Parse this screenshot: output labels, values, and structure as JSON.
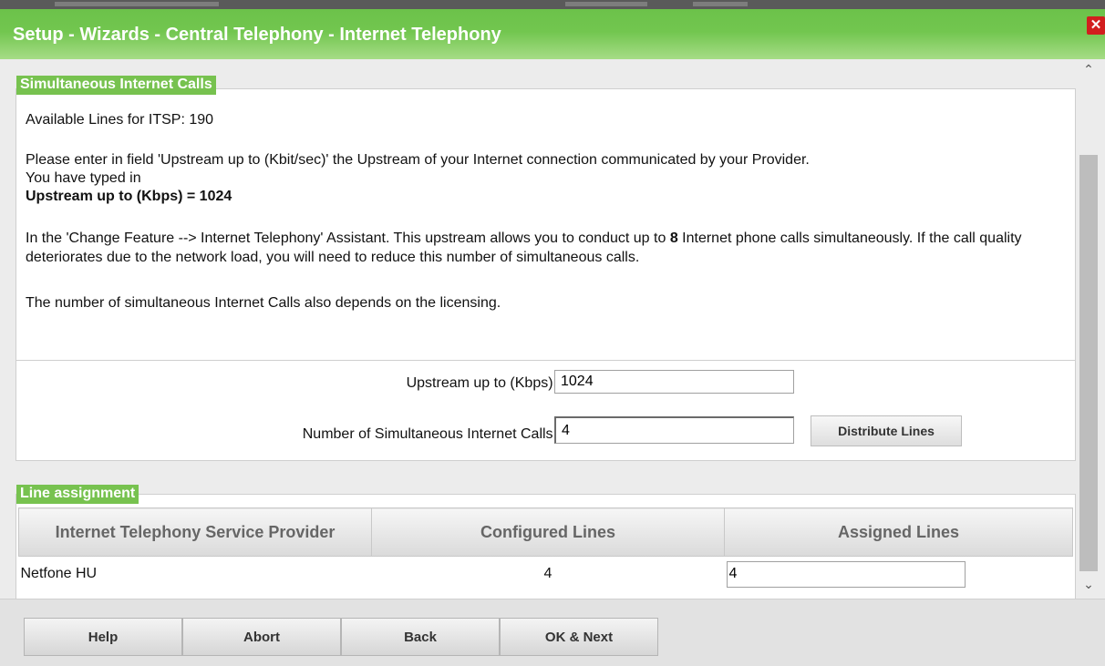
{
  "dialog": {
    "title": "Setup - Wizards - Central Telephony - Internet Telephony",
    "close_icon": "close-icon"
  },
  "colors": {
    "title_bar": "#6cc24a",
    "legend": "#77c24f",
    "close": "#d21e1e"
  },
  "section_calls": {
    "legend": "Simultaneous Internet Calls",
    "available_lines": "Available Lines for ITSP: 190",
    "instruction": "Please enter in field 'Upstream up to (Kbit/sec)' the Upstream of your Internet connection communicated by your Provider.",
    "typed_in": "You have typed in",
    "upstream_summary": "Upstream up to (Kbps) = 1024",
    "feature_pre": "In the 'Change Feature --> Internet Telephony' Assistant. This upstream allows you to conduct up to ",
    "feature_max": "8",
    "feature_post": " Internet phone calls simultaneously. If the call quality deteriorates due to the network load, you will need to reduce this number of simultaneous calls.",
    "licensing_note": "The number of simultaneous Internet Calls also depends on the licensing.",
    "upstream_label": "Upstream up to (Kbps):",
    "upstream_value": "1024",
    "calls_label": "Number of Simultaneous Internet Calls:",
    "calls_value": "4",
    "distribute_button": "Distribute Lines"
  },
  "section_lines": {
    "legend": "Line assignment",
    "columns": [
      "Internet Telephony Service Provider",
      "Configured Lines",
      "Assigned Lines"
    ],
    "rows": [
      {
        "provider": "Netfone HU",
        "configured": "4",
        "assigned": "4"
      }
    ]
  },
  "footer": {
    "buttons": [
      "Help",
      "Abort",
      "Back",
      "OK & Next"
    ]
  }
}
